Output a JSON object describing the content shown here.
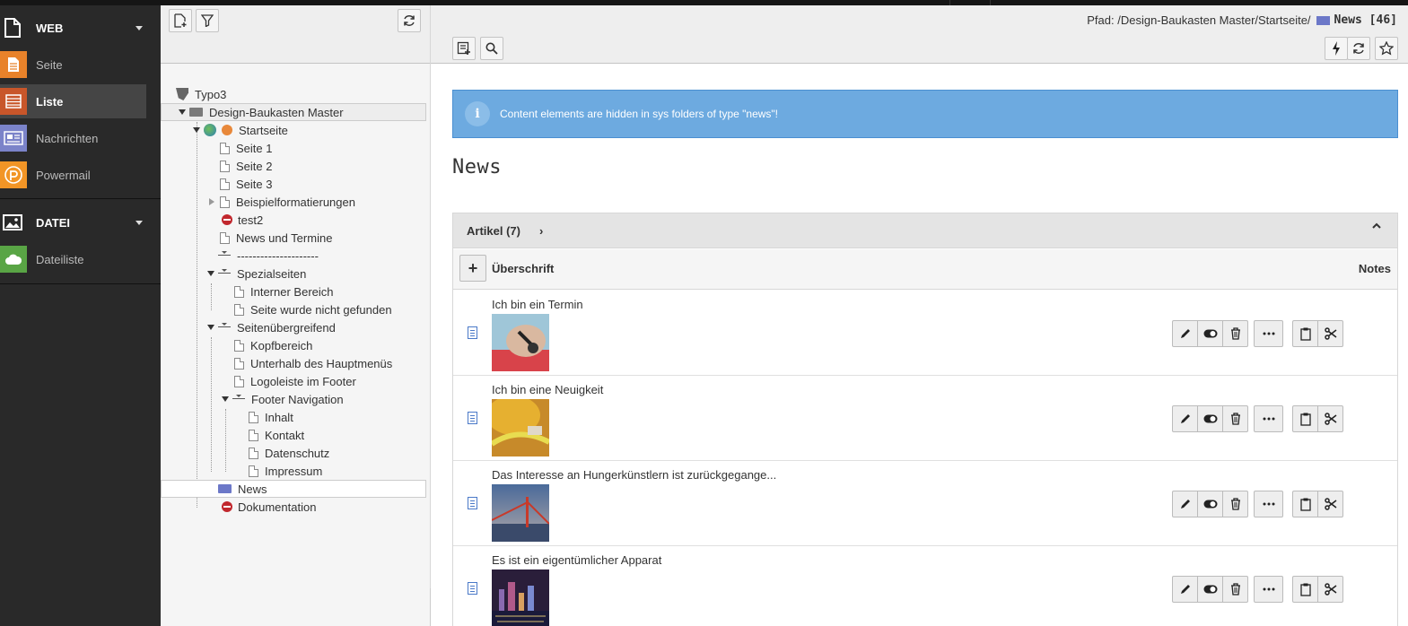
{
  "colors": {
    "module_bg": "#292929",
    "active_bg": "#454545",
    "seite": "#e8822a",
    "liste": "#c8562a",
    "nachrichten": "#7b83c9",
    "powermail": "#f29526",
    "dateiliste": "#59a545",
    "info": "#6daae0",
    "folder": "#6c78c8"
  },
  "modules": {
    "web": {
      "label": "WEB",
      "icon": "page-icon",
      "items": [
        {
          "label": "Seite",
          "icon": "page-module-icon"
        },
        {
          "label": "Liste",
          "icon": "list-module-icon",
          "active": true
        },
        {
          "label": "Nachrichten",
          "icon": "news-module-icon"
        },
        {
          "label": "Powermail",
          "icon": "powermail-icon"
        }
      ]
    },
    "datei": {
      "label": "DATEI",
      "icon": "image-icon",
      "items": [
        {
          "label": "Dateiliste",
          "icon": "filelist-cloud-icon"
        }
      ]
    }
  },
  "tree": {
    "root": "Typo3",
    "nodes": [
      "Design-Baukasten Master",
      "Startseite",
      "Seite 1",
      "Seite 2",
      "Seite 3",
      "Beispielformatierungen",
      "test2",
      "News und Termine",
      "---------------------",
      "Spezialseiten",
      "Interner Bereich",
      "Seite wurde nicht gefunden",
      "Seitenübergreifend",
      "Kopfbereich",
      "Unterhalb des Hauptmenüs",
      "Logoleiste im Footer",
      "Footer Navigation",
      "Inhalt",
      "Kontakt",
      "Datenschutz",
      "Impressum",
      "News",
      "Dokumentation"
    ]
  },
  "header": {
    "path_label": "Pfad: /Design-Baukasten Master/Startseite/",
    "current_page": "News [46]"
  },
  "info_text": "Content elements are hidden in sys folders of type \"news\"!",
  "page_title": "News",
  "panel": {
    "title": "Artikel (7)",
    "chevron": "›",
    "column_header": "Überschrift",
    "notes_header": "Notes",
    "add_label": "+",
    "rows": [
      {
        "title": "Ich bin ein Termin"
      },
      {
        "title": "Ich bin eine Neuigkeit"
      },
      {
        "title": "Das Interesse an Hungerkünstlern ist zurückgegange..."
      },
      {
        "title": "Es ist ein eigentümlicher Apparat"
      }
    ]
  }
}
